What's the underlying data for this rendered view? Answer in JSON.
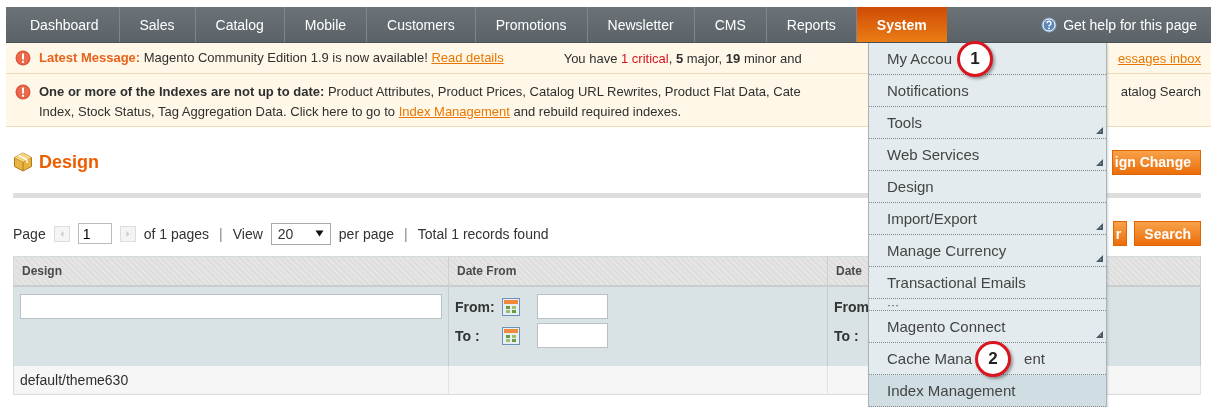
{
  "nav": {
    "items": [
      {
        "label": "Dashboard",
        "selected": false
      },
      {
        "label": "Sales",
        "selected": false
      },
      {
        "label": "Catalog",
        "selected": false
      },
      {
        "label": "Mobile",
        "selected": false
      },
      {
        "label": "Customers",
        "selected": false
      },
      {
        "label": "Promotions",
        "selected": false
      },
      {
        "label": "Newsletter",
        "selected": false
      },
      {
        "label": "CMS",
        "selected": false
      },
      {
        "label": "Reports",
        "selected": false
      },
      {
        "label": "System",
        "selected": true
      }
    ],
    "help": "Get help for this page"
  },
  "messages": [
    {
      "kind": "latest",
      "text": "**Latest Message:** Magento Community Edition 1.9 is now available!",
      "link": "Read details",
      "summary": [
        {
          "text": "You have ",
          "kind": "plain"
        },
        {
          "text": "1 critical",
          "kind": "critical"
        },
        {
          "text": ", ",
          "kind": "plain"
        },
        {
          "text": "5",
          "kind": "bold"
        },
        {
          "text": " major, ",
          "kind": "plain"
        },
        {
          "text": "19",
          "kind": "bold"
        },
        {
          "text": " minor and",
          "kind": "plain"
        }
      ],
      "right_link": "essages inbox"
    },
    {
      "kind": "index",
      "line1": "**One or more of the Indexes are not up to date:** Product Attributes, Product Prices, Catalog URL Rewrites, Product Flat Data, Cate",
      "line1_right": "atalog Search",
      "line2": "Index, Stock Status, Tag Aggregation Data. Click here to go to",
      "link": "Index Management",
      "line2_end": "and rebuild required indexes."
    }
  ],
  "page": {
    "title": "Design",
    "header_button": "ign Change"
  },
  "pager": {
    "page_label": "Page",
    "page": "1",
    "of_pages": "of 1 pages",
    "separator": "|",
    "view_label": "View",
    "per_page": "20",
    "per_page_label": "per page",
    "separator2": "|",
    "total": "Total 1 records found",
    "buttons": [
      {
        "label": "r"
      },
      {
        "label": "Search"
      }
    ]
  },
  "table": {
    "columns": [
      {
        "label": "Design",
        "kind": "text"
      },
      {
        "label": "Date From",
        "kind": "range"
      },
      {
        "label": "Date",
        "kind": "range_cut"
      }
    ],
    "filter_labels": {
      "from": "From:",
      "to": "To :",
      "from_cut": "From",
      "to_cut": "To :"
    },
    "rows": [
      {
        "cells": [
          "default/theme630"
        ]
      }
    ]
  },
  "menu": {
    "items": [
      {
        "kind": "item",
        "label": "My Accou",
        "submenu": false,
        "selected": false,
        "callout": {
          "number": "1"
        }
      },
      {
        "kind": "item",
        "label": "Notifications",
        "submenu": false,
        "selected": false
      },
      {
        "kind": "item",
        "label": "Tools",
        "submenu": true,
        "selected": false
      },
      {
        "kind": "item",
        "label": "Web Services",
        "submenu": true,
        "selected": false
      },
      {
        "kind": "item",
        "label": "Design",
        "submenu": false,
        "selected": false
      },
      {
        "kind": "item",
        "label": "Import/Export",
        "submenu": true,
        "selected": false
      },
      {
        "kind": "item",
        "label": "Manage Currency",
        "submenu": true,
        "selected": false
      },
      {
        "kind": "item",
        "label": "Transactional Emails",
        "submenu": false,
        "selected": false
      },
      {
        "kind": "more",
        "label": "···"
      },
      {
        "kind": "item",
        "label": "Magento Connect",
        "submenu": true,
        "selected": false
      },
      {
        "kind": "item",
        "label": "Cache Mana",
        "label_end": "ent",
        "submenu": false,
        "selected": false,
        "callout": {
          "number": "2"
        }
      },
      {
        "kind": "item",
        "label": "Index Management",
        "submenu": false,
        "selected": true
      }
    ]
  }
}
